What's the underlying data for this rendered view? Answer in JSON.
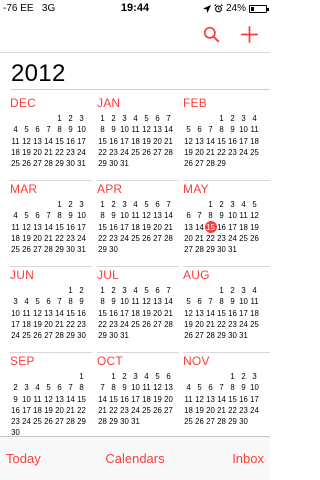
{
  "status_bar": {
    "signal": "-76",
    "carrier": "EE",
    "network": "3G",
    "time": "19:44",
    "battery_percent": "24%",
    "battery_level": 0.24
  },
  "toolbar": {
    "accent_color": "#fc3d39",
    "icons": [
      "search-icon",
      "add-icon"
    ]
  },
  "year": "2012",
  "months": [
    {
      "name": "DEC",
      "offset": 4,
      "days": 31
    },
    {
      "name": "JAN",
      "offset": 0,
      "days": 31
    },
    {
      "name": "FEB",
      "offset": 3,
      "days": 29
    },
    {
      "name": "MAR",
      "offset": 4,
      "days": 31
    },
    {
      "name": "APR",
      "offset": 0,
      "days": 30
    },
    {
      "name": "MAY",
      "offset": 2,
      "days": 31,
      "today": 15
    },
    {
      "name": "JUN",
      "offset": 5,
      "days": 30
    },
    {
      "name": "JUL",
      "offset": 0,
      "days": 31
    },
    {
      "name": "AUG",
      "offset": 3,
      "days": 31
    },
    {
      "name": "SEP",
      "offset": 6,
      "days": 30
    },
    {
      "name": "OCT",
      "offset": 1,
      "days": 31
    },
    {
      "name": "NOV",
      "offset": 4,
      "days": 30
    }
  ],
  "tabs": {
    "today": "Today",
    "calendars": "Calendars",
    "inbox": "Inbox"
  }
}
